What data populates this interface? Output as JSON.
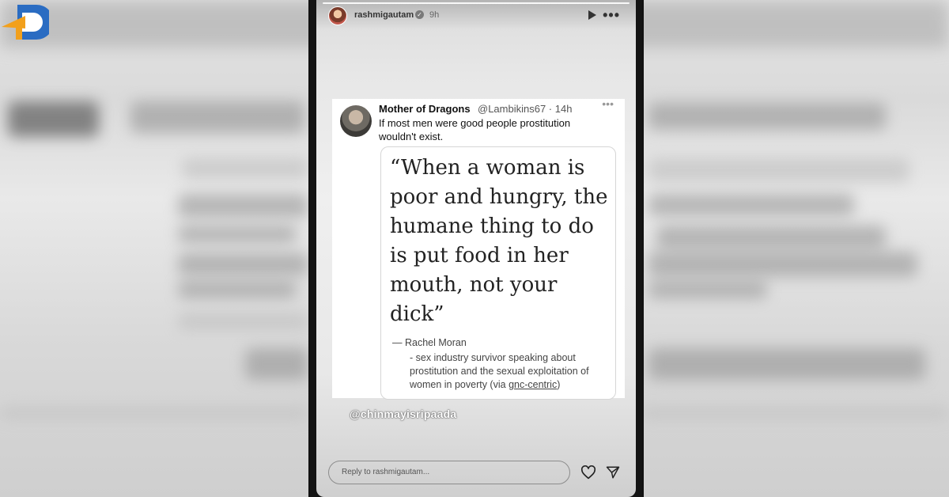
{
  "story": {
    "username": "rashmigautam",
    "time": "9h",
    "reply_placeholder": "Reply to rashmigautam...",
    "mention": "@chinmayisripaada"
  },
  "tweet": {
    "display_name": "Mother of Dragons",
    "handle_time": "@Lambikins67 · 14h",
    "text": "If most men were good people prostitution wouldn't exist.",
    "quote": "“When a woman is poor and hungry, the humane thing to do is put food in her mouth, not your dick”",
    "attribution": "—   Rachel Moran",
    "attribution_desc_prefix": "- sex industry survivor speaking about prostitution and the sexual exploitation of women in poverty (via ",
    "attribution_link": "gnc-centric",
    "attribution_desc_suffix": ")"
  },
  "icons": {
    "verified": "verified-badge-icon",
    "play": "play-icon",
    "more": "more-options-icon",
    "heart": "heart-icon",
    "send": "send-icon",
    "logo": "watermark-logo-icon"
  },
  "colors": {
    "story_bg": "#141414",
    "logo_blue": "#2a6cc2",
    "logo_orange": "#f2a01c"
  }
}
